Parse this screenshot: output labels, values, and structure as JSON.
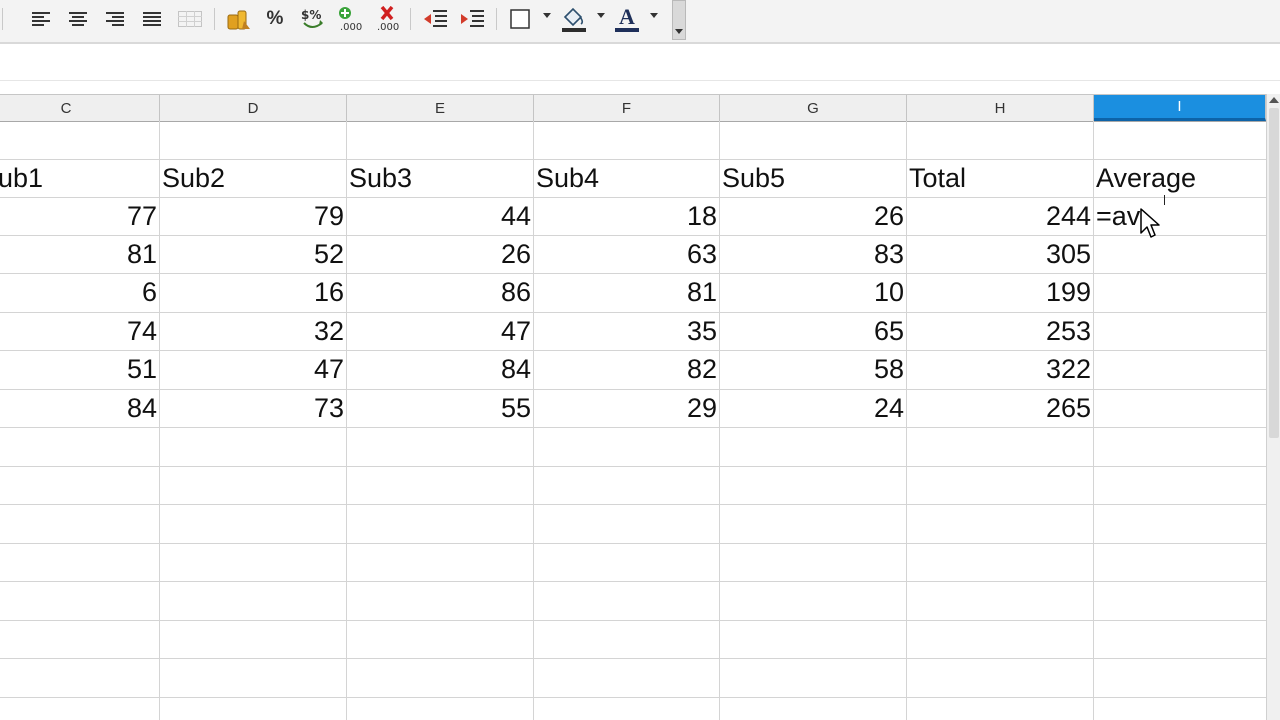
{
  "toolbar": {
    "icons": [
      "align-left-icon",
      "align-center-icon",
      "align-right-icon",
      "justify-icon",
      "merge-cells-icon",
      "currency-icon",
      "percent-icon",
      "number-format-icon",
      "add-decimal-icon",
      "delete-decimal-icon",
      "decrease-indent-icon",
      "increase-indent-icon",
      "borders-icon",
      "background-color-icon",
      "font-color-icon"
    ],
    "percent_label": "%",
    "font_color_label": "A"
  },
  "columns": [
    "C",
    "D",
    "E",
    "F",
    "G",
    "H",
    "I"
  ],
  "selected_column": "I",
  "headers": [
    "ub1",
    "Sub2",
    "Sub3",
    "Sub4",
    "Sub5",
    "Total",
    "Average"
  ],
  "rows": [
    [
      "77",
      "79",
      "44",
      "18",
      "26",
      "244"
    ],
    [
      "81",
      "52",
      "26",
      "63",
      "83",
      "305"
    ],
    [
      "6",
      "16",
      "86",
      "81",
      "10",
      "199"
    ],
    [
      "74",
      "32",
      "47",
      "35",
      "65",
      "253"
    ],
    [
      "51",
      "47",
      "84",
      "82",
      "58",
      "322"
    ],
    [
      "84",
      "73",
      "55",
      "29",
      "24",
      "265"
    ]
  ],
  "active_cell_input": "=av",
  "colors": {
    "selection": "#1b8fe0",
    "grid": "#d4d4d4",
    "header_bg": "#efefef"
  }
}
